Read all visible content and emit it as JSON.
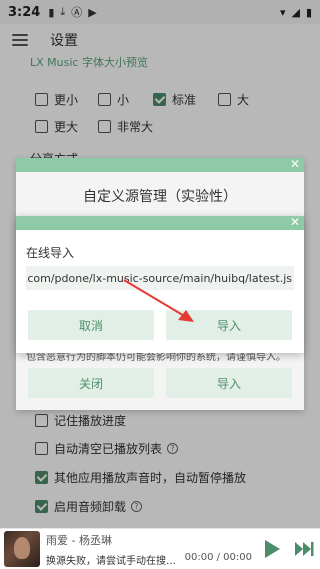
{
  "status_bar": {
    "time": "3:24"
  },
  "header": {
    "title": "设置"
  },
  "font_preview": {
    "label": "LX Music 字体大小预览",
    "options": [
      {
        "label": "更小",
        "checked": false
      },
      {
        "label": "小",
        "checked": false
      },
      {
        "label": "标准",
        "checked": true
      },
      {
        "label": "大",
        "checked": false
      },
      {
        "label": "更大",
        "checked": false
      },
      {
        "label": "非常大",
        "checked": false
      }
    ]
  },
  "section_partial": "分享方式",
  "play_settings": [
    {
      "label": "记住播放进度",
      "checked": false,
      "info": false
    },
    {
      "label": "自动清空已播放列表",
      "checked": false,
      "info": true
    },
    {
      "label": "其他应用播放声音时，自动暂停播放",
      "checked": true,
      "info": false
    },
    {
      "label": "启用音频卸载",
      "checked": true,
      "info": true
    }
  ],
  "outer_dialog": {
    "title": "自定义源管理（实验性）",
    "desc": "包含恶意行为的脚本仍可能会影响你的系统，请谨慎导入。",
    "close_label": "关闭",
    "import_label": "导入"
  },
  "inner_dialog": {
    "label": "在线导入",
    "url_value": "ntent.com/pdone/lx-music-source/main/huibq/latest.js",
    "cancel_label": "取消",
    "import_label": "导入"
  },
  "player": {
    "title": "雨爱 - 杨丞琳",
    "status": "换源失败，请尝试手动在搜…",
    "time": "00:00 / 00:00"
  },
  "colors": {
    "accent": "#4b8d69",
    "dialog_bar": "#8fcaa6",
    "button_bg": "#e1efe6"
  }
}
